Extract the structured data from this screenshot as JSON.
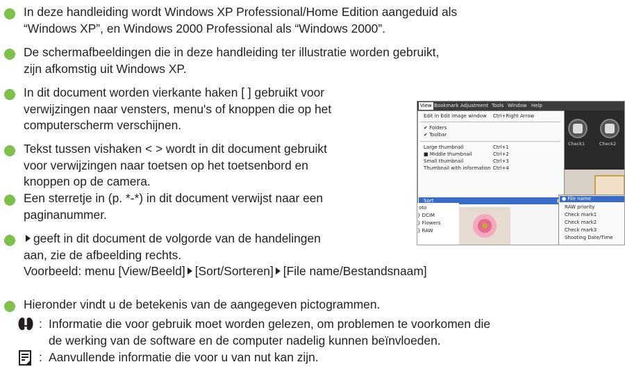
{
  "bullets": [
    {
      "lines": [
        "In deze handleiding wordt Windows XP Professional/Home Edition aangeduid als",
        "“Windows XP”, en Windows 2000 Professional als “Windows 2000”."
      ]
    },
    {
      "lines": [
        "De schermafbeeldingen die in deze handleiding ter illustratie worden gebruikt,",
        "zijn afkomstig uit Windows XP."
      ]
    },
    {
      "lines": [
        "In dit document worden vierkante haken [ ] gebruikt voor",
        "verwijzingen naar vensters, menu's of knoppen die op het",
        "computerscherm verschijnen."
      ]
    },
    {
      "lines": [
        "Tekst tussen vishaken < > wordt in dit document gebruikt",
        "voor verwijzingen naar toetsen op het toetsenbord en",
        "knoppen op de camera."
      ]
    },
    {
      "lines": [
        "Een sterretje in (p. *-*) in dit document verwijst naar een",
        "paginanummer."
      ]
    },
    {
      "lines": [
        "geeft in dit document de volgorde van de handelingen",
        "aan, zie de afbeelding rechts."
      ]
    },
    {
      "lines": [
        "Hieronder vindt u de betekenis van de aangegeven pictogrammen."
      ]
    }
  ],
  "example": {
    "prefix": "Voorbeeld: menu [View/Beeld]",
    "step2": "[Sort/Sorteren]",
    "step3": "[File name/Bestandsnaam]"
  },
  "notes": [
    {
      "icon": "caution-icon",
      "lines": [
        "Informatie die voor gebruik moet worden gelezen, om problemen te voorkomen die",
        "de werking van de software en de computer nadelig kunnen beïnvloeden."
      ]
    },
    {
      "icon": "memo-icon",
      "lines": [
        "Aanvullende informatie die voor u van nut kan zijn."
      ]
    }
  ],
  "screenshot": {
    "menubar": [
      "View",
      "Bookmark",
      "Adjustment",
      "Tools",
      "Window",
      "Help"
    ],
    "menu": [
      {
        "label": "Edit in Edit image window",
        "shortcut": "Ctrl+Right Arrow"
      },
      {
        "label": "✔ Folders",
        "shortcut": ""
      },
      {
        "label": "✔ Toolbar",
        "shortcut": ""
      },
      {
        "label": "Large thumbnail",
        "shortcut": "Ctrl+1"
      },
      {
        "label": "■ Middle thumbnail",
        "shortcut": "Ctrl+2"
      },
      {
        "label": "Small thumbnail",
        "shortcut": "Ctrl+3"
      },
      {
        "label": "Thumbnail with information",
        "shortcut": "Ctrl+4"
      },
      {
        "label": "Sort",
        "shortcut": ""
      }
    ],
    "submenu": [
      "● File name",
      "RAW priority",
      "Check mark1",
      "Check mark2",
      "Check mark3",
      "Shooting Date/Time"
    ],
    "check_buttons": [
      "Check1",
      "Check2"
    ],
    "folders": [
      "oto",
      "} DCIM",
      "} Flowers",
      "} RAW"
    ]
  }
}
